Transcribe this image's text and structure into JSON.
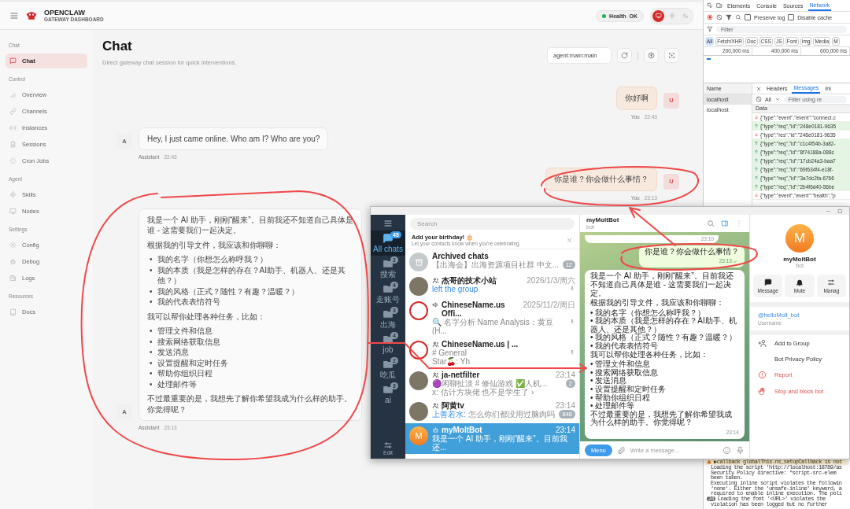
{
  "brand": {
    "name": "OPENCLAW",
    "subtitle": "GATEWAY DASHBOARD"
  },
  "health": {
    "label": "Health",
    "value": "OK",
    "ok": true
  },
  "theme": [
    {
      "kind": "system",
      "selected": true
    },
    {
      "kind": "light",
      "selected": false
    },
    {
      "kind": "dark",
      "selected": false
    }
  ],
  "sidebar": {
    "groups": [
      {
        "title": "Chat",
        "items": [
          {
            "label": "Chat",
            "selected": true
          }
        ]
      },
      {
        "title": "Control",
        "items": [
          {
            "label": "Overview",
            "selected": false
          },
          {
            "label": "Channels",
            "selected": false
          },
          {
            "label": "Instances",
            "selected": false
          },
          {
            "label": "Sessions",
            "selected": false
          },
          {
            "label": "Cron Jobs",
            "selected": false
          }
        ]
      },
      {
        "title": "Agent",
        "items": [
          {
            "label": "Skills",
            "selected": false
          },
          {
            "label": "Nodes",
            "selected": false
          }
        ]
      },
      {
        "title": "Settings",
        "items": [
          {
            "label": "Config",
            "selected": false
          },
          {
            "label": "Debug",
            "selected": false
          },
          {
            "label": "Logs",
            "selected": false
          }
        ]
      },
      {
        "title": "Resources",
        "items": [
          {
            "label": "Docs",
            "selected": false
          }
        ]
      }
    ]
  },
  "page": {
    "title": "Chat",
    "subtitle": "Direct gateway chat session for quick interventions."
  },
  "session": {
    "value": "agent:main:main"
  },
  "messages": [
    {
      "kind": "user",
      "avatar": "U",
      "text": "你好啊",
      "sender": "You",
      "time": "22:43"
    },
    {
      "kind": "assistant",
      "avatar": "A",
      "text": "Hey, I just came online. Who am I? Who are you?",
      "sender": "Assistant",
      "time": "22:43"
    },
    {
      "kind": "user",
      "avatar": "U",
      "text": "你是谁？你会做什么事情？",
      "sender": "You",
      "time": "23:13"
    },
    {
      "kind": "assistant",
      "avatar": "A",
      "sender": "Assistant",
      "time": "23:13",
      "blocks": [
        {
          "kind": "p",
          "text": "我是一个 AI 助手，刚刚“醒来”。目前我还不知道自己具体是谁 - 这需要我们一起决定。"
        },
        {
          "kind": "p",
          "text": "根据我的引导文件，我应该和你聊聊："
        },
        {
          "kind": "list",
          "marker": "•",
          "items": [
            "我的名字（你想怎么称呼我？）",
            "我的本质（我是怎样的存在？AI助手、机器人、还是其他？）",
            "我的风格（正式？随性？有趣？温暖？）",
            "我的代表表情符号"
          ]
        },
        {
          "kind": "p",
          "text": "我可以帮你处理各种任务，比如："
        },
        {
          "kind": "list",
          "marker": "•",
          "items": [
            "管理文件和信息",
            "搜索网络获取信息",
            "发送消息",
            "设置提醒和定时任务",
            "帮助你组织日程",
            "处理邮件等"
          ]
        },
        {
          "kind": "p",
          "text": "不过最重要的是，我想先了解你希望我成为什么样的助手。你觉得呢？"
        }
      ]
    }
  ],
  "telegram": {
    "folders": [
      {
        "label": "All chats",
        "badge": "45",
        "selected": true
      },
      {
        "label": "搜索",
        "badge": "2",
        "selected": false
      },
      {
        "label": "走账号",
        "badge": "4",
        "selected": false
      },
      {
        "label": "出海",
        "badge": "3",
        "selected": false
      },
      {
        "label": "job",
        "badge": "4",
        "selected": false
      },
      {
        "label": "吃瓜",
        "badge": "2",
        "selected": false
      },
      {
        "label": "ai",
        "badge": "3",
        "selected": false
      }
    ],
    "edit_label": "Edit",
    "search_placeholder": "Search",
    "birthday": {
      "title": "Add your birthday! 🎂",
      "text": "Let your contacts know when you're celebrating."
    },
    "chats": [
      {
        "kind": "archive",
        "avatar": {
          "kind": "archive"
        },
        "name": "Archived chats",
        "preview": "【出海会】出海资源项目社群 中文...",
        "badge": "12",
        "muted": true,
        "pinned": false,
        "service": false,
        "selected": false
      },
      {
        "kind": "group",
        "avatar": {
          "kind": "photo"
        },
        "name": "杰哥的技术小站",
        "date": "2026/1/3/周六",
        "preview": "left the group",
        "pinned": true,
        "service": true,
        "selected": false
      },
      {
        "kind": "channel",
        "avatar": {
          "kind": "seal"
        },
        "name": "ChineseName.us Offi...",
        "date": "2025/11/2/周日",
        "preview": "🔍 名字分析 Name Analysis：黄豆 (H...",
        "pinned": true,
        "service": false,
        "selected": false
      },
      {
        "kind": "group",
        "avatar": {
          "kind": "seal"
        },
        "name": "ChineseName.us | ...",
        "preview": "# General",
        "preview2": "Star🍒: Yh",
        "pinned": true,
        "service": false,
        "selected": false
      },
      {
        "kind": "group",
        "avatar": {
          "kind": "photo"
        },
        "name": "ja-netfilter",
        "date": "23:14",
        "preview": "🟣闲聊扯淡 # 修仙游戏 ✅人机...",
        "preview2": "x: 估计方块佬 也不是学生了 ›",
        "badge": "2",
        "muted": true,
        "pinned": false,
        "service": false,
        "selected": false
      },
      {
        "kind": "group",
        "avatar": {
          "kind": "photo"
        },
        "name": "阿黄tv",
        "date": "23:14",
        "preview_sender": "上善若水:",
        "preview": "怎么你们都没用过脑肉吗",
        "badge": "846",
        "muted": true,
        "pinned": false,
        "service": false,
        "selected": false
      },
      {
        "kind": "bot",
        "avatar": {
          "kind": "letter",
          "letter": "M"
        },
        "name": "myMoltBot",
        "date": "23:14",
        "preview": "我是一个 AI 助手，刚刚“醒来”。目前我还...",
        "pinned": false,
        "service": false,
        "selected": true
      }
    ],
    "chat": {
      "title": "myMoltBot",
      "status": "bot"
    },
    "messages": [
      {
        "kind": "partial",
        "out": false,
        "time": "23:10"
      },
      {
        "kind": "text",
        "out": true,
        "read": true,
        "time": "23:13",
        "paragraphs": [
          [
            "你是谁？你会做什么事情？"
          ]
        ]
      },
      {
        "kind": "text",
        "out": false,
        "read": false,
        "time": "23:14",
        "paragraphs": [
          [
            "我是一个 AI 助手，刚刚“醒来”。目前我还不知道自己具体是谁 - 这需要我们一起决定。"
          ],
          [
            "根据我的引导文件，我应该和你聊聊："
          ],
          [
            "• 我的名字（你想怎么称呼我？）",
            "• 我的本质（我是怎样的存在？AI助手、机器人、还是其他？）",
            "• 我的风格（正式？随性？有趣？温暖？）",
            "• 我的代表表情符号",
            "我可以帮你处理各种任务，比如："
          ],
          [
            "• 管理文件和信息",
            "• 搜索网络获取信息",
            "• 发送消息",
            "• 设置提醒和定时任务",
            "• 帮助你组织日程",
            "• 处理邮件等",
            "不过最重要的是，我想先了解你希望我成为什么样的助手。你觉得呢？"
          ]
        ]
      }
    ],
    "compose": {
      "menu": "Menu",
      "placeholder": "Write a message..."
    },
    "profile": {
      "letter": "M",
      "name": "myMoltBot",
      "status": "bot",
      "actions": [
        {
          "kind": "message",
          "label": "Message"
        },
        {
          "kind": "mute",
          "label": "Mute"
        },
        {
          "kind": "manage",
          "label": "Manag"
        }
      ],
      "username": "@helloMolt_bot",
      "username_label": "Username",
      "items": [
        {
          "kind": "add",
          "label": "Add to Group"
        },
        {
          "kind": "plain",
          "label": "Bot Privacy Policy"
        },
        {
          "kind": "report",
          "label": "Report"
        },
        {
          "kind": "block",
          "label": "Stop and block bot"
        }
      ]
    }
  },
  "devtools": {
    "tabs": [
      {
        "label": "Elements",
        "selected": false
      },
      {
        "label": "Console",
        "selected": false
      },
      {
        "label": "Sources",
        "selected": false
      },
      {
        "label": "Network",
        "selected": true
      }
    ],
    "preserve_log": {
      "label": "Preserve log",
      "checked": false
    },
    "disable_cache": {
      "label": "Disable cache",
      "checked": false
    },
    "filter_placeholder": "Filter",
    "type_filters": [
      {
        "label": "All",
        "selected": true
      },
      {
        "label": "Fetch/XHR",
        "selected": false
      },
      {
        "label": "Doc",
        "selected": false
      },
      {
        "label": "CSS",
        "selected": false
      },
      {
        "label": "JS",
        "selected": false
      },
      {
        "label": "Font",
        "selected": false
      },
      {
        "label": "Img",
        "selected": false
      },
      {
        "label": "Media",
        "selected": false
      },
      {
        "label": "M",
        "selected": false
      }
    ],
    "timeline": [
      "200,000 ms",
      "400,000 ms",
      "600,000 ms"
    ],
    "name_header": "Name",
    "requests": [
      {
        "name": "localhost",
        "selected": true
      },
      {
        "name": "localhost",
        "selected": false
      }
    ],
    "detail_tabs": [
      {
        "label": "Headers",
        "selected": false
      },
      {
        "label": "Messages",
        "selected": true
      },
      {
        "label": "Ini",
        "selected": false
      }
    ],
    "message_filter": {
      "type": "All",
      "placeholder": "Filter using re"
    },
    "data_header": "Data",
    "frames": [
      {
        "kind": "in",
        "text": "{\"type\":\"event\",\"event\":\"connect.c"
      },
      {
        "kind": "out",
        "text": "{\"type\":\"req\",\"id\":\"248e0181-9635"
      },
      {
        "kind": "in",
        "text": "{\"type\":\"res\",\"id\":\"248e0181-9635"
      },
      {
        "kind": "out",
        "text": "{\"type\":\"req\",\"id\":\"c1c4f54b-3a82-"
      },
      {
        "kind": "out",
        "text": "{\"type\":\"req\",\"id\":\"8f74188a-088c"
      },
      {
        "kind": "out",
        "text": "{\"type\":\"req\",\"id\":\"17cb24a3-baa7"
      },
      {
        "kind": "out",
        "text": "{\"type\":\"req\",\"id\":\"69f634f4-e18f-"
      },
      {
        "kind": "out",
        "text": "{\"type\":\"req\",\"id\":\"3a7dc2fa-6766"
      },
      {
        "kind": "out",
        "text": "{\"type\":\"req\",\"id\":\"2b4f6d40-56be"
      },
      {
        "kind": "in",
        "text": "{\"type\":\"event\",\"event\":\"health\",\"p"
      }
    ],
    "console": [
      {
        "kind": "warning",
        "text": "▶callback globalThis.ns_setupCallback is not"
      },
      {
        "kind": "log",
        "text": "Loading the script 'http://localhost:18789/as"
      },
      {
        "kind": "log",
        "text": "Security Policy directive: \"script-src-elem"
      },
      {
        "kind": "log",
        "text": "been taken."
      },
      {
        "kind": "log",
        "text": "Executing inline script violates the followin"
      },
      {
        "kind": "log",
        "text": "'none'. Either the 'unsafe-inline' keyword, a"
      },
      {
        "kind": "log",
        "text": "required to enable inline execution. The poli"
      },
      {
        "kind": "group",
        "count": "24",
        "text": "Loading the font '<URL>' violates the"
      },
      {
        "kind": "log",
        "text": "violation has been logged but no further"
      }
    ]
  }
}
